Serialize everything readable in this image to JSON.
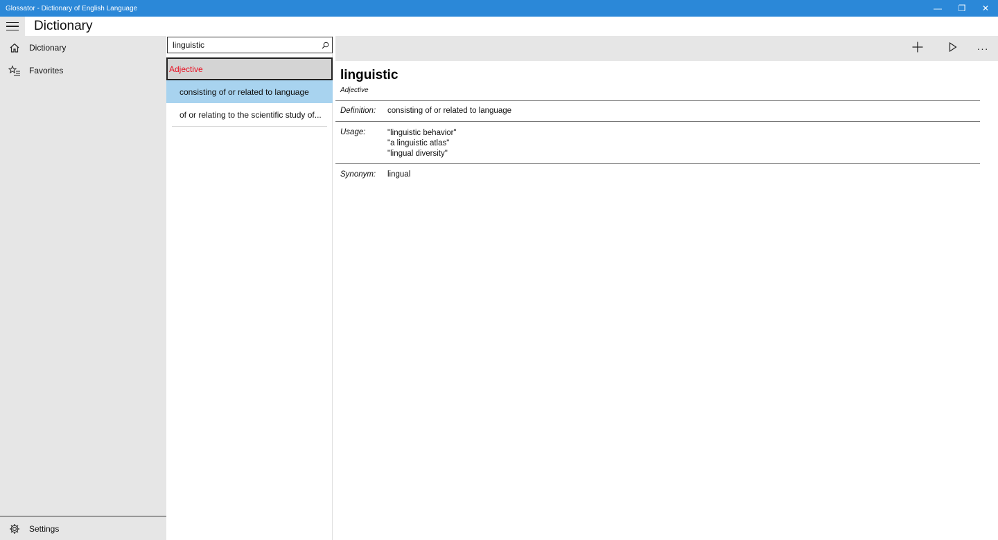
{
  "window": {
    "title": "Glossator - Dictionary of English Language",
    "minimize_glyph": "—",
    "maximize_glyph": "❐",
    "close_glyph": "✕"
  },
  "header": {
    "page_title": "Dictionary"
  },
  "nav": {
    "items": [
      {
        "label": "Dictionary",
        "icon": "home-icon"
      },
      {
        "label": "Favorites",
        "icon": "star-list-icon"
      }
    ],
    "settings_label": "Settings"
  },
  "search": {
    "value": "linguistic",
    "placeholder": ""
  },
  "results": {
    "group_label": "Adjective",
    "senses": [
      "consisting of or related to language",
      "of or relating to the scientific study of..."
    ]
  },
  "toolbar": {
    "add_icon": "plus-icon",
    "play_icon": "play-icon",
    "more_glyph": "···"
  },
  "entry": {
    "word": "linguistic",
    "part_of_speech": "Adjective",
    "definition_label": "Definition:",
    "definition": "consisting of or related to language",
    "usage_label": "Usage:",
    "usage": [
      "\"linguistic behavior\"",
      "\"a linguistic atlas\"",
      "\"lingual diversity\""
    ],
    "synonym_label": "Synonym:",
    "synonym": "lingual"
  },
  "colors": {
    "titlebar": "#2b88d8",
    "nav_bg": "#e6e6e6",
    "selected_sense": "#a8d3ef",
    "group_label_text": "#e81123"
  }
}
